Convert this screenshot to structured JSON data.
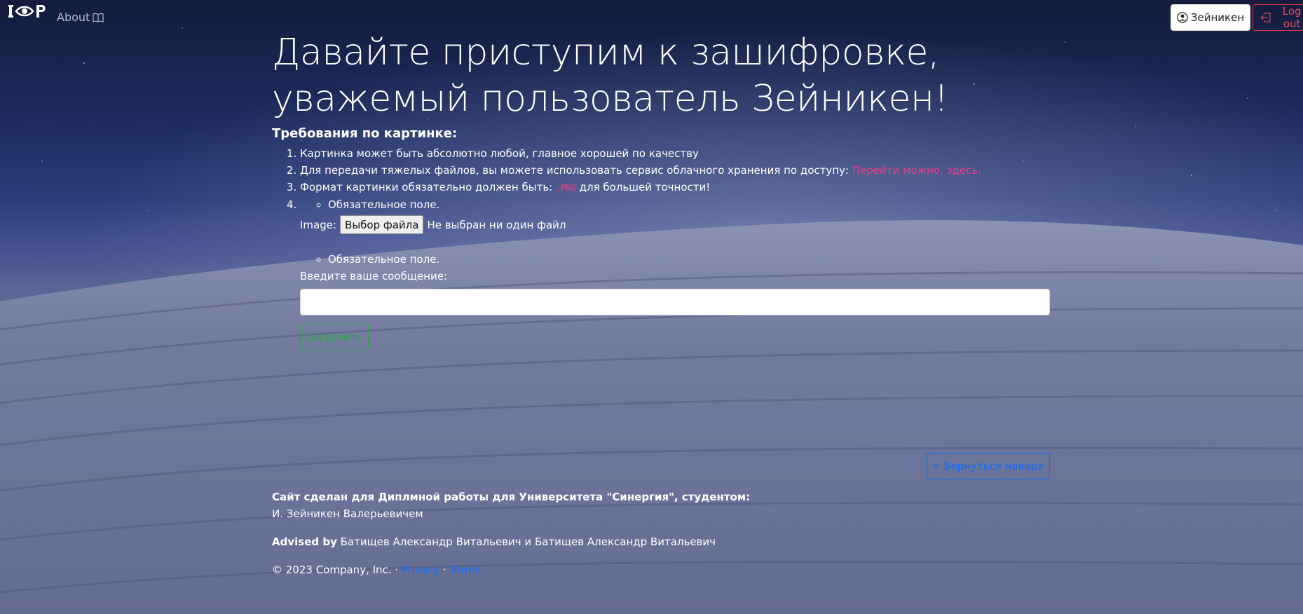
{
  "nav": {
    "logo_text": "I👁P",
    "about_label": "About",
    "about_icon": "book-icon",
    "user_label": "Зейникен",
    "user_icon": "person-circle-icon",
    "logout_label": "Log out",
    "logout_icon": "box-arrow-left-icon"
  },
  "main": {
    "headline": "Давайте приступим к зашифровке, уважемый пользователь Зейникен!",
    "requirements_title": "Требования по картинке:",
    "requirements": [
      "Картинка может быть абсолютно любой, главное хорошей по качеству",
      "Для передачи тяжелых файлов, вы можете использовать сервис облачного хранения по доступу: ",
      "Формат картинки обязательно должен быть: ",
      ""
    ],
    "cloud_link": "Перейти можно, здесь.",
    "png_code": ".PNG",
    "png_suffix": " для большей точности!",
    "form": {
      "required_note_1": "Обязательное поле.",
      "image_label": "Image:",
      "file_button": "Выбор файла",
      "file_status": "Не выбран ни один файл",
      "required_note_2": "Обязательное поле.",
      "message_label": "Введите ваше сообщение:",
      "message_value": "",
      "submit_label": "Загрузить"
    }
  },
  "back_to_top": {
    "label": "Вернуться наверх",
    "icon": "double-chevron-up-icon"
  },
  "footer": {
    "made_for": "Сайт сделан для Диплмной работы для Университета \"Синергия\", студентом:",
    "student": "И. Зейникен Валерьевичем",
    "advised_by_label": "Advised by",
    "advised_by": " Батищев Александр Витальевич и Батищев Александр Витальевич",
    "copyright": "© 2023 Company, Inc. · ",
    "privacy": "Privacy",
    "separator": " · ",
    "terms": "Terms"
  },
  "colors": {
    "pink_link": "#e83e8c",
    "blue_link": "#0d6efd",
    "green_button": "#28a745",
    "red_button": "#dc3545"
  }
}
